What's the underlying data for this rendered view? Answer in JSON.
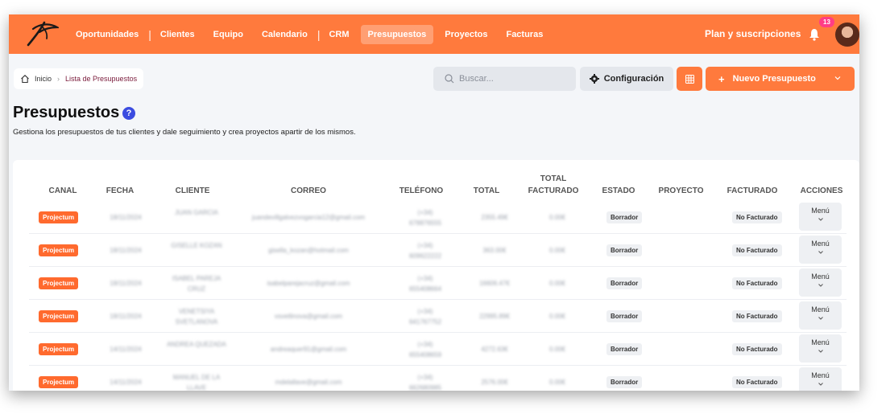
{
  "topbar": {
    "nav": [
      "Oportunidades",
      "Clientes",
      "Equipo",
      "Calendario",
      "CRM",
      "Presupuestos",
      "Proyectos",
      "Facturas"
    ],
    "active": "Presupuestos",
    "plan_label": "Plan y suscripciones",
    "notifications": "13",
    "brand_color": "#ff7a3d"
  },
  "breadcrumb": {
    "home": "Inicio",
    "current": "Lista de Presupuestos"
  },
  "toolbar": {
    "search_placeholder": "Buscar...",
    "config_label": "Configuración",
    "new_label": "Nuevo Presupuesto"
  },
  "page": {
    "title": "Presupuestos",
    "help": "?",
    "subtitle": "Gestiona los presupuestos de tus clientes y dale seguimiento y crea proyectos apartir de los mismos."
  },
  "table": {
    "headers": {
      "canal": "CANAL",
      "fecha": "FECHA",
      "cliente": "CLIENTE",
      "correo": "CORREO",
      "telefono": "TELÉFONO",
      "total": "TOTAL",
      "total_facturado_1": "TOTAL",
      "total_facturado_2": "FACTURADO",
      "estado": "ESTADO",
      "proyecto": "PROYECTO",
      "facturado": "FACTURADO",
      "acciones": "ACCIONES"
    },
    "rows": [
      {
        "canal": "Projectum",
        "fecha": "18/11/2024",
        "cliente": "JUAN GARCIA",
        "correo": "juandevillgalvezvogarcia12@gmail.com",
        "tel1": "(+34)",
        "tel2": "678876555",
        "total": "2355.49€",
        "facturado_total": "0.00€",
        "estado": "Borrador",
        "facturado": "No Facturado",
        "menu": "Menú"
      },
      {
        "canal": "Projectum",
        "fecha": "18/11/2024",
        "cliente": "GISELLE KOZAN",
        "correo": "gisella_kozan@hotmail.com",
        "tel1": "(+34)",
        "tel2": "609622222",
        "total": "363.00€",
        "facturado_total": "0.00€",
        "estado": "Borrador",
        "facturado": "No Facturado",
        "menu": "Menú"
      },
      {
        "canal": "Projectum",
        "fecha": "18/11/2024",
        "cliente": "ISABEL PAREJA CRUZ",
        "correo": "isabelparejacruz@gmail.com",
        "tel1": "(+34)",
        "tel2": "655408664",
        "total": "16606.47€",
        "facturado_total": "0.00€",
        "estado": "Borrador",
        "facturado": "No Facturado",
        "menu": "Menú"
      },
      {
        "canal": "Projectum",
        "fecha": "18/11/2024",
        "cliente": "VENETSIYA SVETLANOVA",
        "correo": "vsvetlinova@gmail.com",
        "tel1": "(+34)",
        "tel2": "641767752",
        "total": "22995.89€",
        "facturado_total": "0.00€",
        "estado": "Borrador",
        "facturado": "No Facturado",
        "menu": "Menú"
      },
      {
        "canal": "Projectum",
        "fecha": "14/11/2024",
        "cliente": "ANDREA QUEZADA",
        "correo": "andreaquer91@gmail.com",
        "tel1": "(+34)",
        "tel2": "655408659",
        "total": "4272.63€",
        "facturado_total": "0.00€",
        "estado": "Borrador",
        "facturado": "No Facturado",
        "menu": "Menú"
      },
      {
        "canal": "Projectum",
        "fecha": "14/11/2024",
        "cliente": "MANUEL DE LA LLAVE",
        "correo": "mdelallave@gmail.com",
        "tel1": "(+34)",
        "tel2": "662680985",
        "total": "2576.00€",
        "facturado_total": "0.00€",
        "estado": "Borrador",
        "facturado": "No Facturado",
        "menu": "Menú"
      }
    ]
  }
}
